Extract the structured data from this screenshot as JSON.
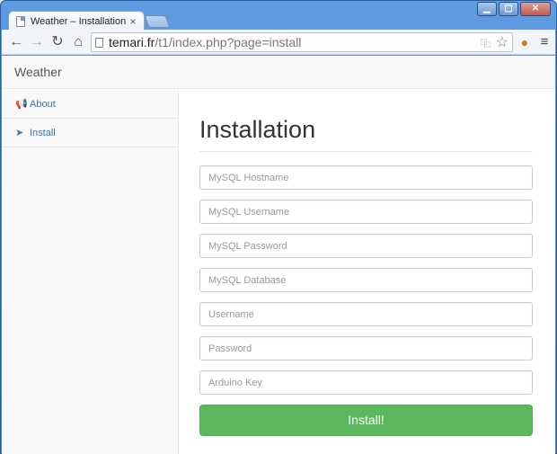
{
  "browser": {
    "tab_title": "Weather – Installation",
    "tab_close": "×",
    "url_host": "temari.fr",
    "url_path": "/t1/index.php?page=install",
    "controls": {
      "minimize": "▁",
      "maximize": "▢",
      "close": "✕"
    },
    "icons": {
      "back": "←",
      "forward": "→",
      "reload": "↻",
      "home": "⌂",
      "translate": "⿻",
      "star": "☆",
      "extension": "●",
      "menu": "≡"
    }
  },
  "navbar": {
    "brand": "Weather"
  },
  "sidebar": {
    "items": [
      {
        "label": "About",
        "icon": "📢"
      },
      {
        "label": "Install",
        "icon": "➤"
      }
    ]
  },
  "main": {
    "title": "Installation",
    "fields": [
      {
        "placeholder": "MySQL Hostname"
      },
      {
        "placeholder": "MySQL Username"
      },
      {
        "placeholder": "MySQL Password"
      },
      {
        "placeholder": "MySQL Database"
      },
      {
        "placeholder": "Username"
      },
      {
        "placeholder": "Password"
      },
      {
        "placeholder": "Arduino Key"
      }
    ],
    "submit_label": "Install!"
  },
  "colors": {
    "accent_link": "#337ab7",
    "success_button": "#5cb85c",
    "window_frame": "#4a86d0"
  }
}
